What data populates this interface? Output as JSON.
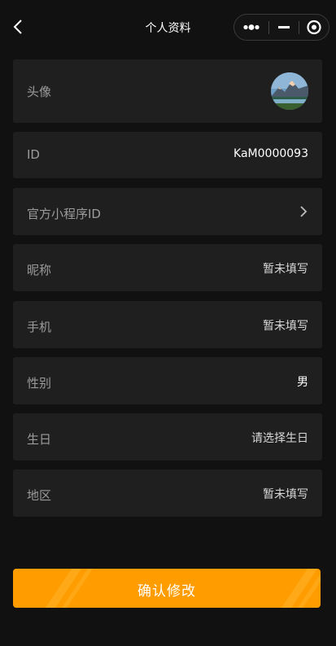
{
  "nav": {
    "title": "个人资料",
    "back_icon": "chevron-left-icon",
    "capsule_icons": [
      "more-dots-icon",
      "minimize-icon",
      "close-circle-icon"
    ]
  },
  "profile": {
    "avatar": {
      "label": "头像",
      "icon": "avatar-image"
    },
    "id": {
      "label": "ID",
      "value": "KaM0000093"
    },
    "miniprogram": {
      "label": "官方小程序ID",
      "icon": "chevron-right-icon"
    },
    "nickname": {
      "label": "昵称",
      "value": "暂未填写"
    },
    "phone": {
      "label": "手机",
      "value": "暂未填写"
    },
    "gender": {
      "label": "性别",
      "value": "男"
    },
    "birthday": {
      "label": "生日",
      "value": "请选择生日"
    },
    "region": {
      "label": "地区",
      "value": "暂未填写"
    }
  },
  "actions": {
    "confirm_label": "确认修改"
  },
  "colors": {
    "background": "#111111",
    "row": "#1f1f1f",
    "accent": "#ff9d00",
    "label": "#9b9b9b"
  }
}
